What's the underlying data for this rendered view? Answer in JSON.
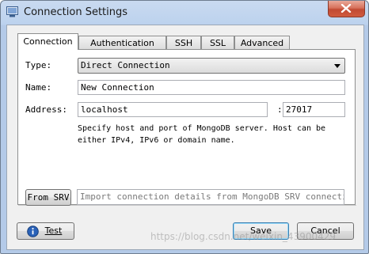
{
  "window": {
    "title": "Connection Settings"
  },
  "tabs": [
    {
      "label": "Connection",
      "active": true
    },
    {
      "label": "Authentication",
      "active": false
    },
    {
      "label": "SSH",
      "active": false
    },
    {
      "label": "SSL",
      "active": false
    },
    {
      "label": "Advanced",
      "active": false
    }
  ],
  "form": {
    "type_label": "Type:",
    "type_value": "Direct Connection",
    "name_label": "Name:",
    "name_value": "New Connection",
    "address_label": "Address:",
    "host_value": "localhost",
    "port_separator": ":",
    "port_value": "27017",
    "description_line1": "Specify host and port of MongoDB server. Host can be",
    "description_line2": "either IPv4, IPv6 or domain name."
  },
  "srv": {
    "button_label": "From SRV",
    "input_placeholder": "Import connection details from MongoDB SRV connection…"
  },
  "footer": {
    "test_label": "Test",
    "save_label": "Save",
    "cancel_label": "Cancel"
  },
  "watermark": "https://blog.csdn.net/weixin_43900429",
  "colors": {
    "titlebar": "#bcd2ee",
    "close_button": "#c14a33",
    "info_icon": "#2a62b8"
  }
}
